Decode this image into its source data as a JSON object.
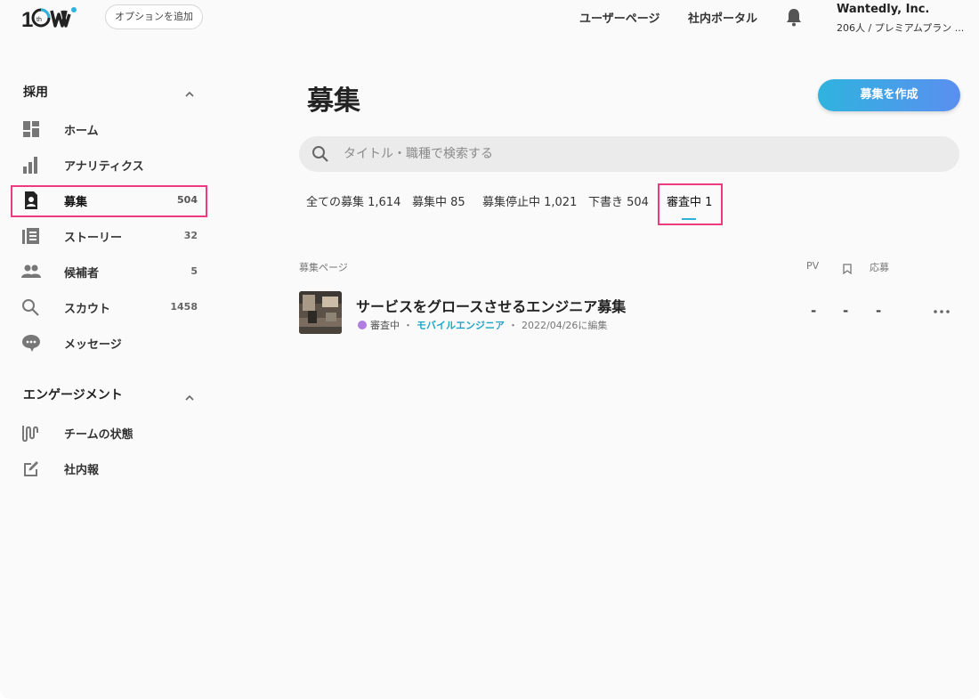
{
  "topbar": {
    "option_button": "オプションを追加",
    "user_page": "ユーザーページ",
    "portal": "社内ポータル",
    "company_name": "Wantedly, Inc.",
    "company_sub": "206人 / プレミアムプラン ..."
  },
  "sidebar": {
    "recruit_heading": "採用",
    "engage_heading": "エンゲージメント",
    "items": [
      {
        "label": "ホーム",
        "count": "",
        "icon": "dashboard-icon"
      },
      {
        "label": "アナリティクス",
        "count": "",
        "icon": "bar-chart-icon"
      },
      {
        "label": "募集",
        "count": "504",
        "icon": "job-post-icon"
      },
      {
        "label": "ストーリー",
        "count": "32",
        "icon": "story-icon"
      },
      {
        "label": "候補者",
        "count": "5",
        "icon": "people-icon"
      },
      {
        "label": "スカウト",
        "count": "1458",
        "icon": "search-icon"
      },
      {
        "label": "メッセージ",
        "count": "",
        "icon": "chat-icon"
      }
    ],
    "engage_items": [
      {
        "label": "チームの状態",
        "icon": "wave-icon"
      },
      {
        "label": "社内報",
        "icon": "edit-icon"
      }
    ]
  },
  "main": {
    "title": "募集",
    "create_button": "募集を作成",
    "search_placeholder": "タイトル・職種で検索する",
    "tabs": [
      {
        "label": "全ての募集 1,614"
      },
      {
        "label": "募集中 85"
      },
      {
        "label": "募集停止中 1,021"
      },
      {
        "label": "下書き 504"
      },
      {
        "label": "審査中 1"
      }
    ],
    "columns": {
      "page": "募集ページ",
      "pv": "PV",
      "apply": "応募"
    },
    "rows": [
      {
        "title": "サービスをグロースさせるエンジニア募集",
        "status": "審査中",
        "category": "モバイルエンジニア",
        "edited": "2022/04/26に編集",
        "pv": "-",
        "bookmarks": "-",
        "applies": "-"
      }
    ]
  },
  "colors": {
    "accent": "#31b0de",
    "highlight": "#ee3a7f",
    "status_review": "#b07de0"
  }
}
